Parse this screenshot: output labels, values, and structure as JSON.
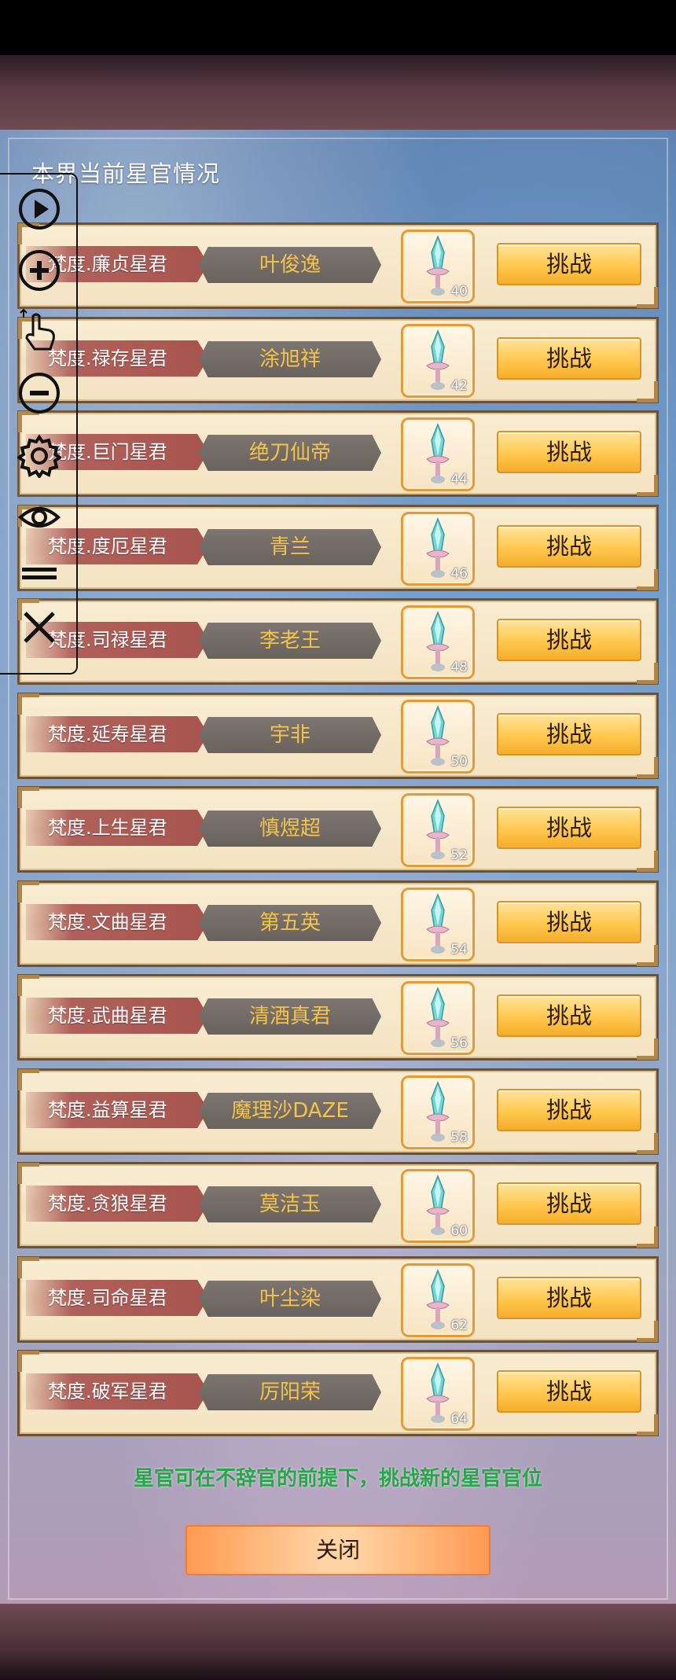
{
  "title": "本界当前星官情况",
  "rows": [
    {
      "title": "梵度.廉贞星君",
      "name": "叶俊逸",
      "level": "40",
      "button": "挑战"
    },
    {
      "title": "梵度.禄存星君",
      "name": "涂旭祥",
      "level": "42",
      "button": "挑战"
    },
    {
      "title": "梵度.巨门星君",
      "name": "绝刀仙帝",
      "level": "44",
      "button": "挑战"
    },
    {
      "title": "梵度.度厄星君",
      "name": "青兰",
      "level": "46",
      "button": "挑战"
    },
    {
      "title": "梵度.司禄星君",
      "name": "李老王",
      "level": "48",
      "button": "挑战"
    },
    {
      "title": "梵度.延寿星君",
      "name": "宇非",
      "level": "50",
      "button": "挑战"
    },
    {
      "title": "梵度.上生星君",
      "name": "慎煜超",
      "level": "52",
      "button": "挑战"
    },
    {
      "title": "梵度.文曲星君",
      "name": "第五英",
      "level": "54",
      "button": "挑战"
    },
    {
      "title": "梵度.武曲星君",
      "name": "清酒真君",
      "level": "56",
      "button": "挑战"
    },
    {
      "title": "梵度.益算星君",
      "name": "魔理沙DAZE",
      "level": "58",
      "button": "挑战"
    },
    {
      "title": "梵度.贪狼星君",
      "name": "莫洁玉",
      "level": "60",
      "button": "挑战"
    },
    {
      "title": "梵度.司命星君",
      "name": "叶尘染",
      "level": "62",
      "button": "挑战"
    },
    {
      "title": "梵度.破军星君",
      "name": "厉阳荣",
      "level": "64",
      "button": "挑战"
    }
  ],
  "notice": "星官可在不辞官的前提下，挑战新的星官官位",
  "close_button": "关闭",
  "toolbar_icons": [
    "play-icon",
    "zoom-in-icon",
    "tap-gesture-icon",
    "zoom-out-icon",
    "gear-icon",
    "eye-icon",
    "menu-lines-icon",
    "close-icon"
  ],
  "colors": {
    "name_text": "#f3c34a",
    "notice_text": "#27a74a",
    "button_bg": "#ffc84d",
    "row_bg": "#f3e3c1"
  }
}
